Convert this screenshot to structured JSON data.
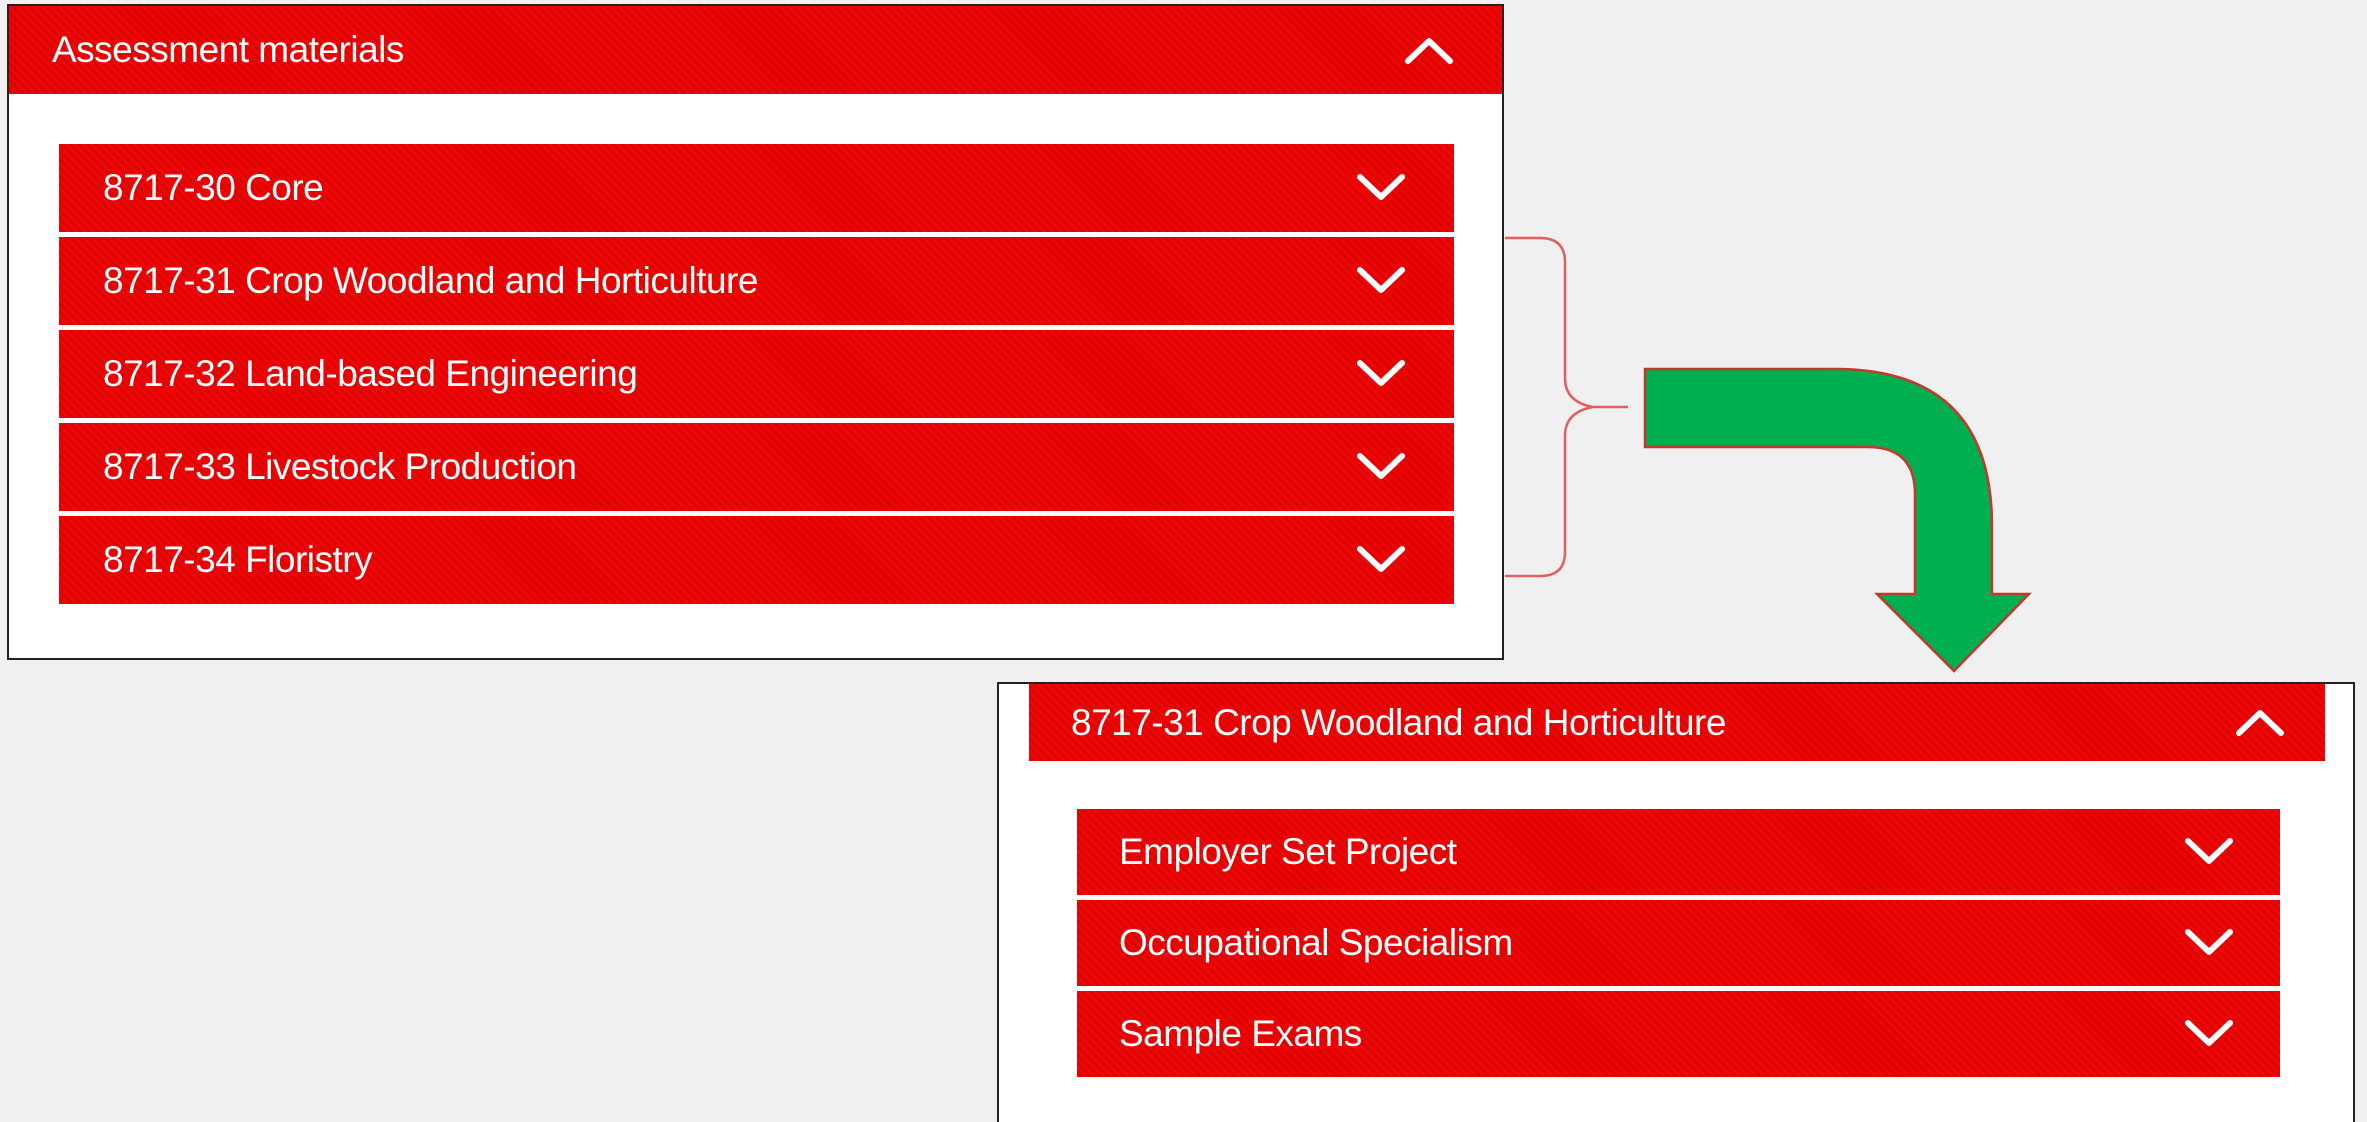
{
  "panel1": {
    "header": {
      "label": "Assessment materials",
      "icon": "chevron-up-icon"
    },
    "items": [
      {
        "label": "8717-30 Core",
        "icon": "chevron-down-icon"
      },
      {
        "label": "8717-31 Crop Woodland and Horticulture",
        "icon": "chevron-down-icon"
      },
      {
        "label": "8717-32 Land-based Engineering",
        "icon": "chevron-down-icon"
      },
      {
        "label": "8717-33 Livestock Production",
        "icon": "chevron-down-icon"
      },
      {
        "label": "8717-34 Floristry",
        "icon": "chevron-down-icon"
      }
    ]
  },
  "panel2": {
    "header": {
      "label": "8717-31 Crop Woodland and Horticulture",
      "icon": "chevron-up-icon"
    },
    "items": [
      {
        "label": "Employer Set Project",
        "icon": "chevron-down-icon"
      },
      {
        "label": "Occupational Specialism",
        "icon": "chevron-down-icon"
      },
      {
        "label": "Sample Exams",
        "icon": "chevron-down-icon"
      }
    ]
  },
  "annotation": {
    "bracket_color": "#e06060",
    "arrow_color": "#00b050",
    "arrow_outline": "#c0392b"
  },
  "colors": {
    "accordion_red": "#e60000",
    "page_background": "#f0f0f0",
    "panel_background": "#ffffff",
    "text": "#ffffff"
  }
}
